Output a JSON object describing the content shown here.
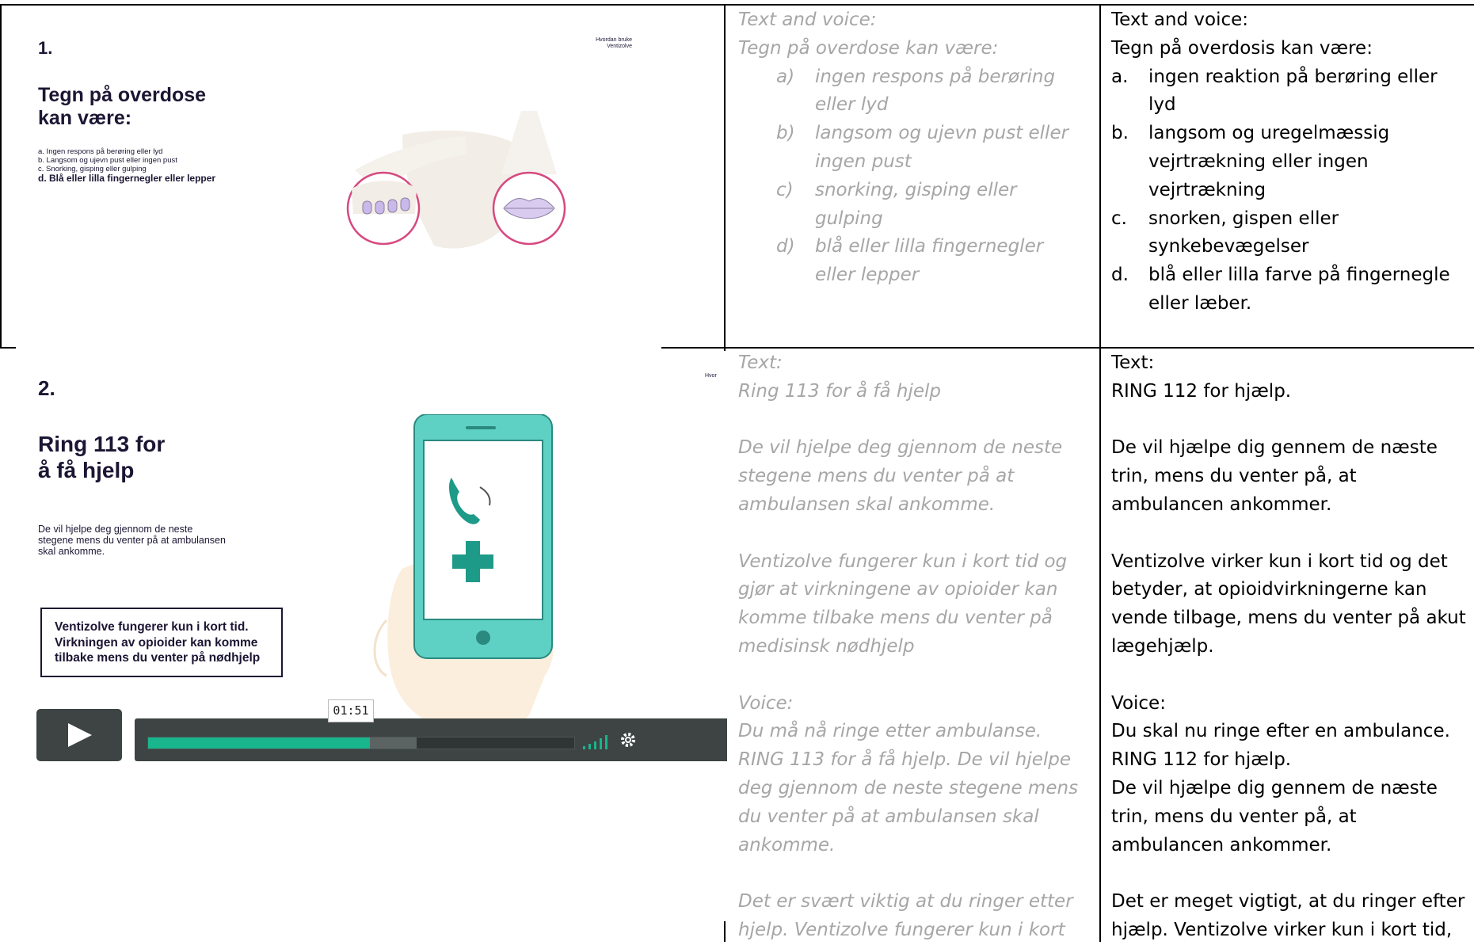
{
  "slide1": {
    "number": "1.",
    "corner": [
      "Hvordan bruke",
      "Ventizolve"
    ],
    "title": [
      "Tegn på overdose",
      "kan være:"
    ],
    "items": [
      "a. Ingen respons på berøring eller lyd",
      "b. Langsom og ujevn pust eller ingen pust",
      "c. Snorking, gisping eller gulping",
      "d. Blå eller lilla fingernegler eller lepper"
    ],
    "colors": {
      "circle": "#d6497f",
      "nails": "#c9b9ea",
      "lips": "#d9cbf0",
      "skin": "#f2ede6"
    }
  },
  "slide2": {
    "number": "2.",
    "corner": "Hvor",
    "title": [
      "Ring 113 for",
      "å få hjelp"
    ],
    "body": [
      "De vil hjelpe deg gjennom de neste",
      "stegene mens du venter på at ambulansen",
      "skal ankomme."
    ],
    "callout": [
      "Ventizolve fungerer kun i kort tid.",
      "Virkningen av opioider kan komme",
      "tilbake mens du venter på nødhjelp"
    ],
    "player": {
      "time": "01:51",
      "progress": 0.52,
      "buffered": 0.63
    },
    "colors": {
      "phone": "#5fd0c4",
      "phone_dark": "#2a8a7f",
      "icon": "#1e9a88",
      "hand": "#fbeedc",
      "progress": "#19b58d",
      "player_bg": "#3d4443"
    }
  },
  "norwegian": {
    "row1": {
      "heading": "Text and voice:",
      "intro": "Tegn på overdose kan være:",
      "items": [
        {
          "marker": "a)",
          "lines": [
            "ingen respons på berøring",
            "eller lyd"
          ]
        },
        {
          "marker": "b)",
          "lines": [
            " langsom og ujevn pust eller",
            "ingen pust"
          ]
        },
        {
          "marker": "c)",
          "lines": [
            " snorking, gisping eller",
            "gulping"
          ]
        },
        {
          "marker": "d)",
          "lines": [
            "blå eller lilla fingernegler",
            "eller lepper"
          ]
        }
      ]
    },
    "row2": {
      "text_heading": "Text:",
      "text_line": "Ring 113 for å få hjelp",
      "para1": [
        "De vil hjelpe deg gjennom de neste",
        "stegene mens du venter på at",
        "ambulansen skal ankomme."
      ],
      "para2": [
        "Ventizolve fungerer kun i kort tid og",
        "gjør at virkningene av opioider kan",
        "komme tilbake mens du venter på",
        "medisinsk nødhjelp"
      ],
      "voice_heading": "Voice:",
      "voice": [
        "Du må nå ringe etter ambulanse.",
        "RING 113 for å få hjelp. De vil hjelpe",
        "deg gjennom de neste stegene mens",
        "du venter på at ambulansen skal",
        "ankomme."
      ],
      "para3": [
        "Det er svært viktig at du ringer etter",
        "hjelp. Ventizolve fungerer kun i kort"
      ]
    }
  },
  "danish": {
    "row1": {
      "heading": "Text and voice:",
      "intro": "Tegn på overdosis kan være:",
      "items": [
        {
          "marker": "a.",
          "lines": [
            "ingen reaktion på berøring eller",
            "lyd"
          ]
        },
        {
          "marker": "b.",
          "lines": [
            "langsom og uregelmæssig",
            "vejrtrækning eller ingen",
            "vejrtrækning"
          ]
        },
        {
          "marker": "c.",
          "lines": [
            "snorken, gispen eller",
            "synkebevægelser"
          ]
        },
        {
          "marker": "d.",
          "lines": [
            "blå eller lilla farve på fingernegle",
            "eller læber."
          ]
        }
      ]
    },
    "row2": {
      "text_heading": "Text:",
      "text_line": "RING 112 for hjælp.",
      "para1": [
        "De vil hjælpe dig gennem de næste",
        "trin, mens du venter på, at",
        "ambulancen ankommer."
      ],
      "para2": [
        "Ventizolve virker kun i kort tid og det",
        "betyder, at opioidvirkningerne kan",
        "vende tilbage, mens du venter på akut",
        "lægehjælp."
      ],
      "voice_heading": "Voice:",
      "voice": [
        "Du skal nu ringe efter en ambulance.",
        "RING 112 for hjælp.",
        "De vil hjælpe dig gennem de næste",
        "trin, mens du venter på, at",
        "ambulancen ankommer."
      ],
      "para3": [
        "Det er meget vigtigt, at du ringer efter",
        "hjælp. Ventizolve virker kun i kort tid,"
      ]
    }
  }
}
